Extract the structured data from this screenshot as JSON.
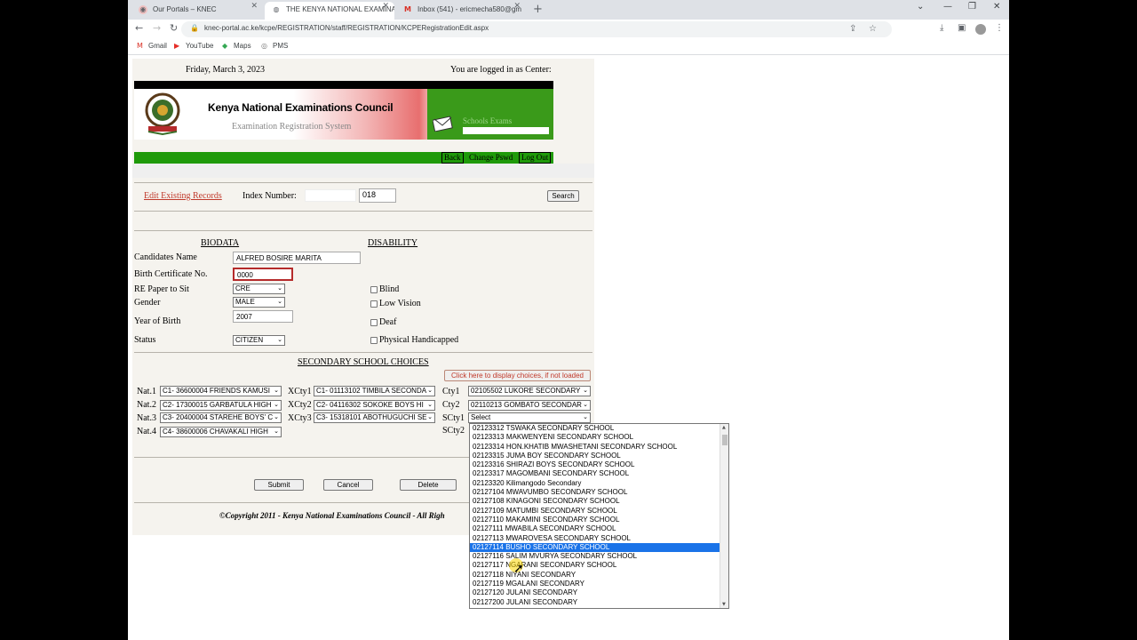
{
  "browser": {
    "tabs": [
      {
        "title": "Our Portals – KNEC",
        "icon": "knec-favicon"
      },
      {
        "title": "THE KENYA NATIONAL EXAMINATI",
        "icon": "globe-icon",
        "active": true
      },
      {
        "title": "Inbox (541) - ericmecha580@gm",
        "icon": "gmail-icon"
      }
    ],
    "url": "knec-portal.ac.ke/kcpe/REGISTRATION/staff/REGISTRATION/KCPERegistrationEdit.aspx",
    "bookmarks": [
      "Gmail",
      "YouTube",
      "Maps",
      "PMS"
    ]
  },
  "header": {
    "date": "Friday, March 3, 2023",
    "logged_in": "You are logged in as Center:",
    "org_title": "Kenya National Examinations Council",
    "system_title": "Examination Registration System",
    "schools_exams": "Schools Exams",
    "menu": {
      "back": "Back",
      "change_pswd": "Change Pswd",
      "logout": "Log Out"
    }
  },
  "search": {
    "edit_link": "Edit Existing Records",
    "index_label": "Index Number:",
    "index_prefix": "",
    "index_value": "018",
    "search_button": "Search"
  },
  "biodata": {
    "heading": "BIODATA",
    "fields": {
      "name_label": "Candidates Name",
      "name_value": "ALFRED BOSIRE MARITA",
      "birthcert_label": "Birth Certificate No.",
      "birthcert_value": "0000",
      "re_label": "RE Paper to Sit",
      "re_value": "CRE",
      "gender_label": "Gender",
      "gender_value": "MALE",
      "yob_label": "Year of Birth",
      "yob_value": "2007",
      "status_label": "Status",
      "status_value": "CITIZEN"
    }
  },
  "disability": {
    "heading": "DISABILITY",
    "options": [
      "Blind",
      "Low Vision",
      "Deaf",
      "Physical Handicapped"
    ]
  },
  "choices": {
    "heading": "SECONDARY SCHOOL CHOICES",
    "load_button": "Click here to display choices, if not loaded",
    "nat": [
      {
        "label": "Nat.1",
        "value": "C1- 36600004 FRIENDS KAMUSI"
      },
      {
        "label": "Nat.2",
        "value": "C2- 17300015 GARBATULA HIGH"
      },
      {
        "label": "Nat.3",
        "value": "C3- 20400004 STAREHE BOYS' C"
      },
      {
        "label": "Nat.4",
        "value": "C4- 38600006 CHAVAKALI HIGH"
      }
    ],
    "xcty": [
      {
        "label": "XCty1",
        "value": "C1- 01113102 TIMBILA SECONDA"
      },
      {
        "label": "XCty2",
        "value": "C2- 04116302 SOKOKE BOYS HI"
      },
      {
        "label": "XCty3",
        "value": "C3- 15318101 ABOTHUGUCHI SE"
      }
    ],
    "cty": [
      {
        "label": "Cty1",
        "value": "02105502 LUKORE SECONDARY"
      },
      {
        "label": "Cty2",
        "value": "02110213 GOMBATO SECONDAR"
      },
      {
        "label": "SCty1",
        "value": "Select"
      },
      {
        "label": "SCty2",
        "value": ""
      }
    ]
  },
  "actions": {
    "submit": "Submit",
    "cancel": "Cancel",
    "delete": "Delete"
  },
  "footer": {
    "copyright": "©Copyright 2011 - Kenya National Examinations Council - All Righ"
  },
  "dropdown_options": [
    "02123312 TSWAKA SECONDARY SCHOOL",
    "02123313 MAKWENYENI SECONDARY SCHOOL",
    "02123314 HON.KHATIB MWASHETANI SECONDARY SCHOOL",
    "02123315 JUMA BOY SECONDARY SCHOOL",
    "02123316 SHIRAZI BOYS SECONDARY SCHOOL",
    "02123317 MAGOMBANI SECONDARY SCHOOL",
    "02123320 Kilimangodo Secondary",
    "02127104 MWAVUMBO SECONDARY SCHOOL",
    "02127108 KINAGONI SECONDARY SCHOOL",
    "02127109 MATUMBI SECONDARY SCHOOL",
    "02127110 MAKAMINI SECONDARY SCHOOL",
    "02127111 MWABILA SECONDARY SCHOOL",
    "02127113 MWAROVESA SECONDARY SCHOOL",
    "02127114 BUSHO SECONDARY SCHOOL",
    "02127116 SALIM MVURYA SECONDARY SCHOOL",
    "02127117 NGARANI SECONDARY SCHOOL",
    "02127118 NIYANI SECONDARY",
    "02127119 MGALANI SECONDARY",
    "02127120 JULANI SECONDARY",
    "02127200 JULANI SECONDARY"
  ],
  "dropdown_highlighted": "02127114 BUSHO SECONDARY SCHOOL"
}
